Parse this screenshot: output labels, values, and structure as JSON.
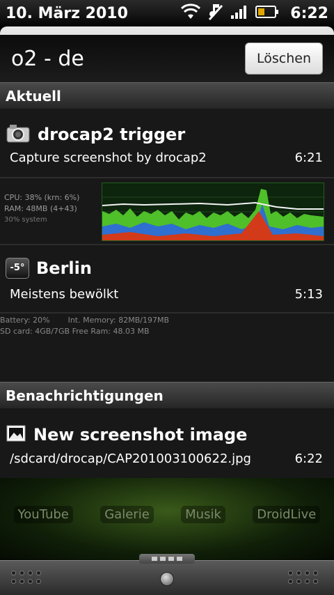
{
  "status_bar": {
    "date": "10. März 2010",
    "time": "6:22"
  },
  "header": {
    "carrier": "o2 - de",
    "clear_button": "Löschen"
  },
  "sections": {
    "current": "Aktuell",
    "notifications": "Benachrichtigungen"
  },
  "ongoing": [
    {
      "title": "drocap2 trigger",
      "subtitle": "Capture screenshot by drocap2",
      "time": "6:21",
      "icon": "camera-icon"
    },
    {
      "title": "Berlin",
      "subtitle": "Meistens bewölkt",
      "time": "5:13",
      "icon": "weather-icon",
      "temp": "-5°"
    }
  ],
  "cpu_widget": {
    "cpu": "CPU: 38% (krn: 6%)",
    "ram": "RAM: 48MB (4+43)",
    "system": "30% system"
  },
  "memory_widget": {
    "line1_left": "Battery: 20%",
    "line1_right": "Int. Memory: 82MB/197MB",
    "line2": "SD card: 4GB/7GB Free Ram: 48.03 MB"
  },
  "notification": {
    "title": "New screenshot image",
    "subtitle": "/sdcard/drocap/CAP201003100622.jpg",
    "time": "6:22",
    "icon": "image-icon"
  },
  "dock": [
    "YouTube",
    "Galerie",
    "Musik",
    "DroidLive"
  ]
}
